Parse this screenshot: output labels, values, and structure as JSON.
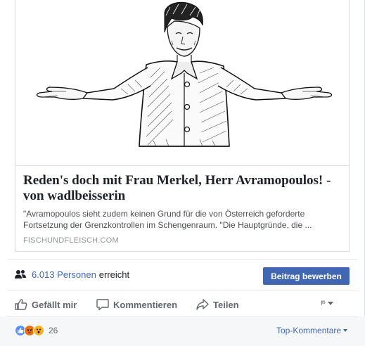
{
  "link_card": {
    "title": "Reden's doch mit Frau Merkel, Herr Avramopoulos! - von wadlbeisserin",
    "description": "\"Avramopoulos sieht zudem keinen Grund für die von Österreich geforderte Fortsetzung der Grenzkontrollen im Schengenraum. \"Die Hauptgründe, die ...",
    "domain": "FISCHUNDFLEISCH.COM"
  },
  "reach": {
    "count": "6.013 Personen",
    "suffix": "erreicht",
    "icon": "people-icon"
  },
  "boost": {
    "label": "Beitrag bewerben"
  },
  "actions": {
    "like_label": "Gefällt mir",
    "comment_label": "Kommentieren",
    "share_label": "Teilen",
    "audience_glyph": "f²³"
  },
  "reactions": {
    "types": [
      "like",
      "angry",
      "wow"
    ],
    "count": "26"
  },
  "comments_sort": {
    "label": "Top-Kommentare"
  },
  "colors": {
    "accent": "#4267b2",
    "text": "#1d2129",
    "muted": "#606770",
    "like": "#5890ff",
    "angry": "#e9710f",
    "wow": "#f7b125"
  }
}
